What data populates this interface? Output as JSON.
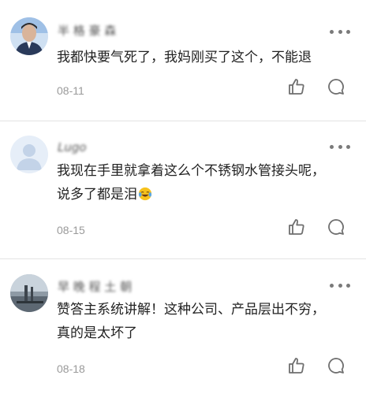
{
  "comments": [
    {
      "username": "半 格 豪 森",
      "avatar_icon": "person-avatar-icon",
      "text_lines": [
        "我都快要气死了，我妈刚买了这个，不能退"
      ],
      "date": "08-11"
    },
    {
      "username": "Lugo",
      "avatar_icon": "default-avatar-icon",
      "text_lines": [
        "我现在手里就拿着这么个不锈钢水管接头呢，",
        "说多了都是泪"
      ],
      "emoji": "laughing-crying-emoji",
      "date": "08-15"
    },
    {
      "username": "早 晚 程 土 朝",
      "avatar_icon": "landscape-avatar-icon",
      "text_lines": [
        "赞答主系统讲解！这种公司、产品层出不穷，",
        "真的是太坏了"
      ],
      "date": "08-18"
    }
  ],
  "actions": {
    "like_icon": "thumbs-up-icon",
    "reply_icon": "comment-bubble-icon",
    "more_icon": "more-dots-icon"
  },
  "colors": {
    "text": "#222222",
    "meta": "#9a9a9a",
    "divider": "#e3e3e3",
    "icon": "#6f6f6f"
  }
}
